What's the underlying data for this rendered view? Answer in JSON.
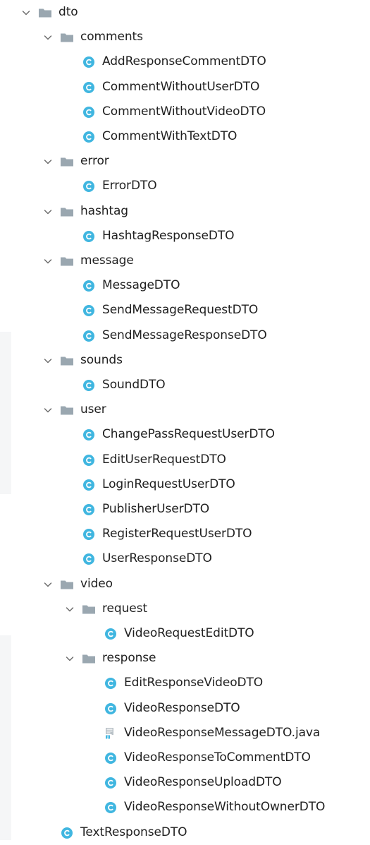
{
  "colors": {
    "folder": "#9aa7b0",
    "class_icon": "#40b6e0",
    "chevron": "#6e6e6e",
    "text": "#1f1f1f"
  },
  "tree": [
    {
      "label": "dto",
      "kind": "folder",
      "depth": 0,
      "expanded": true
    },
    {
      "label": "comments",
      "kind": "folder",
      "depth": 1,
      "expanded": true
    },
    {
      "label": "AddResponseCommentDTO",
      "kind": "class",
      "depth": 2
    },
    {
      "label": "CommentWithoutUserDTO",
      "kind": "class",
      "depth": 2
    },
    {
      "label": "CommentWithoutVideoDTO",
      "kind": "class",
      "depth": 2
    },
    {
      "label": "CommentWithTextDTO",
      "kind": "class",
      "depth": 2
    },
    {
      "label": "error",
      "kind": "folder",
      "depth": 1,
      "expanded": true
    },
    {
      "label": "ErrorDTO",
      "kind": "class",
      "depth": 2
    },
    {
      "label": "hashtag",
      "kind": "folder",
      "depth": 1,
      "expanded": true
    },
    {
      "label": "HashtagResponseDTO",
      "kind": "class",
      "depth": 2
    },
    {
      "label": "message",
      "kind": "folder",
      "depth": 1,
      "expanded": true
    },
    {
      "label": "MessageDTO",
      "kind": "class",
      "depth": 2
    },
    {
      "label": "SendMessageRequestDTO",
      "kind": "class",
      "depth": 2
    },
    {
      "label": "SendMessageResponseDTO",
      "kind": "class",
      "depth": 2
    },
    {
      "label": "sounds",
      "kind": "folder",
      "depth": 1,
      "expanded": true
    },
    {
      "label": "SoundDTO",
      "kind": "class",
      "depth": 2
    },
    {
      "label": "user",
      "kind": "folder",
      "depth": 1,
      "expanded": true
    },
    {
      "label": "ChangePassRequestUserDTO",
      "kind": "class",
      "depth": 2
    },
    {
      "label": "EditUserRequestDTO",
      "kind": "class",
      "depth": 2
    },
    {
      "label": "LoginRequestUserDTO",
      "kind": "class",
      "depth": 2
    },
    {
      "label": "PublisherUserDTO",
      "kind": "class",
      "depth": 2
    },
    {
      "label": "RegisterRequestUserDTO",
      "kind": "class",
      "depth": 2
    },
    {
      "label": "UserResponseDTO",
      "kind": "class",
      "depth": 2
    },
    {
      "label": "video",
      "kind": "folder",
      "depth": 1,
      "expanded": true
    },
    {
      "label": "request",
      "kind": "folder",
      "depth": 2,
      "expanded": true
    },
    {
      "label": "VideoRequestEditDTO",
      "kind": "class",
      "depth": 3
    },
    {
      "label": "response",
      "kind": "folder",
      "depth": 2,
      "expanded": true
    },
    {
      "label": "EditResponseVideoDTO",
      "kind": "class",
      "depth": 3
    },
    {
      "label": "VideoResponseDTO",
      "kind": "class",
      "depth": 3
    },
    {
      "label": "VideoResponseMessageDTO.java",
      "kind": "java-file",
      "depth": 3
    },
    {
      "label": "VideoResponseToCommentDTO",
      "kind": "class",
      "depth": 3
    },
    {
      "label": "VideoResponseUploadDTO",
      "kind": "class",
      "depth": 3
    },
    {
      "label": "VideoResponseWithoutOwnerDTO",
      "kind": "class",
      "depth": 3
    },
    {
      "label": "TextResponseDTO",
      "kind": "class",
      "depth": 1
    }
  ]
}
